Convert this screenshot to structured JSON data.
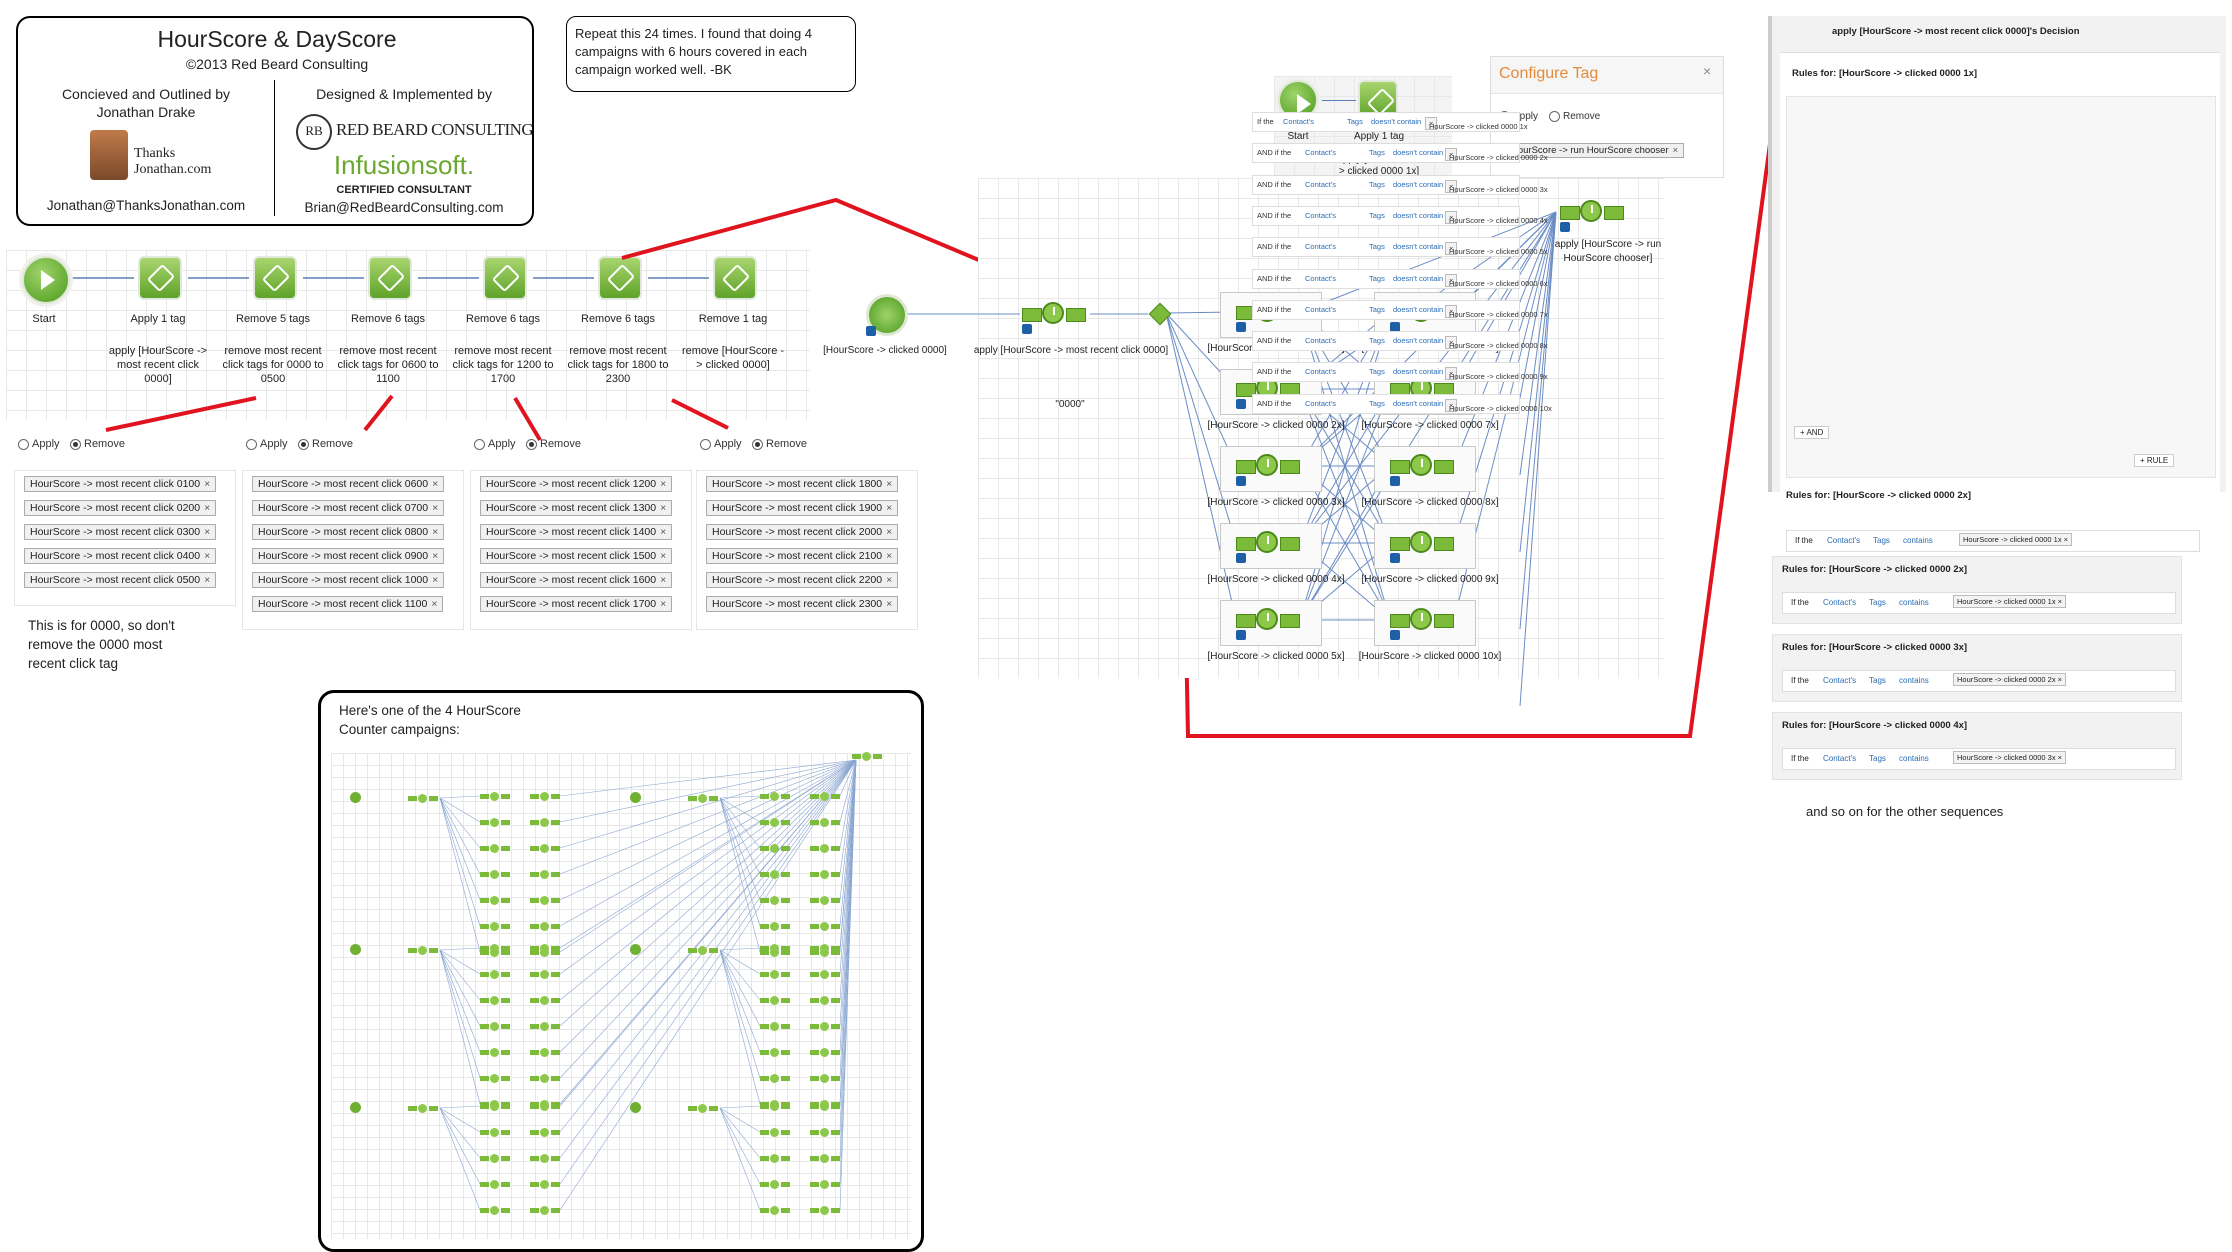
{
  "title_box": {
    "title": "HourScore & DayScore",
    "copyright": "©2013 Red Beard Consulting",
    "conceived_label": "Concieved and Outlined by",
    "conceived_name": "Jonathan Drake",
    "thanks_logo": "Thanks Jonathan.com",
    "email_left": "Jonathan@ThanksJonathan.com",
    "designed_label": "Designed & Implemented by",
    "rbc_logo": "RED BEARD CONSULTING",
    "infusion_logo": "Infusionsoft.",
    "certified": "CERTIFIED CONSULTANT",
    "email_right": "Brian@RedBeardConsulting.com"
  },
  "note": "Repeat this 24 times. I found that doing 4 campaigns with 6 hours covered in each campaign worked well. -BK",
  "flow": {
    "start_label": "Start",
    "nodes": [
      {
        "label": "Apply 1 tag",
        "desc": "apply [HourScore -> most recent click 0000]"
      },
      {
        "label": "Remove 5 tags",
        "desc": "remove most recent click tags for 0000 to 0500"
      },
      {
        "label": "Remove 6 tags",
        "desc": "remove most recent click tags for 0600 to 1100"
      },
      {
        "label": "Remove 6 tags",
        "desc": "remove most recent click tags for 1200 to 1700"
      },
      {
        "label": "Remove 6 tags",
        "desc": "remove most recent click tags for 1800 to 2300"
      },
      {
        "label": "Remove 1 tag",
        "desc": "remove [HourScore -> clicked 0000]"
      }
    ]
  },
  "radio": {
    "apply": "Apply",
    "remove": "Remove"
  },
  "tag_groups": [
    [
      "HourScore -> most recent click 0100",
      "HourScore -> most recent click 0200",
      "HourScore -> most recent click 0300",
      "HourScore -> most recent click 0400",
      "HourScore -> most recent click 0500"
    ],
    [
      "HourScore -> most recent click 0600",
      "HourScore -> most recent click 0700",
      "HourScore -> most recent click 0800",
      "HourScore -> most recent click 0900",
      "HourScore -> most recent click 1000",
      "HourScore -> most recent click 1100"
    ],
    [
      "HourScore -> most recent click 1200",
      "HourScore -> most recent click 1300",
      "HourScore -> most recent click 1400",
      "HourScore -> most recent click 1500",
      "HourScore -> most recent click 1600",
      "HourScore -> most recent click 1700"
    ],
    [
      "HourScore -> most recent click 1800",
      "HourScore -> most recent click 1900",
      "HourScore -> most recent click 2000",
      "HourScore -> most recent click 2100",
      "HourScore -> most recent click 2200",
      "HourScore -> most recent click 2300"
    ]
  ],
  "note_0000": "This is for 0000, so don't remove the 0000 most recent click tag",
  "counter_box_title": "Here's one of the 4 HourScore Counter campaigns:",
  "campaign": {
    "goal_label": "[HourScore -> clicked 0000]",
    "seq_label": "apply [HourScore -> most recent click 0000]",
    "decision_label": "\"0000\"",
    "col1": [
      "[HourScore -> clicked 0000 1x]",
      "[HourScore -> clicked 0000 2x]",
      "[HourScore -> clicked 0000 3x]",
      "[HourScore -> clicked 0000 4x]",
      "[HourScore -> clicked 0000 5x]"
    ],
    "col2": [
      "[HourScore -> clicked 0000 6x]",
      "[HourScore -> clicked 0000 7x]",
      "[HourScore -> clicked 0000 8x]",
      "[HourScore -> clicked 0000 9x]",
      "[HourScore -> clicked 0000 10x]"
    ],
    "chooser_label": "apply [HourScore -> run HourScore chooser]"
  },
  "mini_flow": {
    "start_label": "Start",
    "tag_label": "Apply 1 tag",
    "desc": "apply [HourScore -> clicked 0000 1x]"
  },
  "configure_tag": {
    "title": "Configure Tag",
    "apply": "Apply",
    "remove": "Remove",
    "chip": "HourScore -> run HourScore chooser",
    "close": "×"
  },
  "decision_panel": {
    "header": "apply [HourScore -> most recent click 0000]'s Decision",
    "rules_1x_title": "Rules for: [HourScore -> clicked 0000 1x]",
    "rows": [
      {
        "prefix": "If the",
        "chip": "HourScore -> clicked 0000 1x"
      },
      {
        "prefix": "AND if the",
        "chip": "HourScore -> clicked 0000 2x"
      },
      {
        "prefix": "AND if the",
        "chip": "HourScore -> clicked 0000 3x"
      },
      {
        "prefix": "AND if the",
        "chip": "HourScore -> clicked 0000 4x"
      },
      {
        "prefix": "AND if the",
        "chip": "HourScore -> clicked 0000 5x"
      },
      {
        "prefix": "AND if the",
        "chip": "HourScore -> clicked 0000 6x"
      },
      {
        "prefix": "AND if the",
        "chip": "HourScore -> clicked 0000 7x"
      },
      {
        "prefix": "AND if the",
        "chip": "HourScore -> clicked 0000 8x"
      },
      {
        "prefix": "AND if the",
        "chip": "HourScore -> clicked 0000 9x"
      },
      {
        "prefix": "AND if the",
        "chip": "HourScore -> clicked 0000 10x"
      }
    ],
    "contacts": "Contact's",
    "tags": "Tags",
    "doesnt_contain": "doesn't contain",
    "contains": "contains",
    "add_and": "+ AND",
    "add_rule": "+ RULE",
    "rules_2x_title": "Rules for: [HourScore -> clicked 0000 2x]",
    "rules_2x_chip": "HourScore -> clicked 0000 1x",
    "stack": [
      {
        "title": "Rules for: [HourScore -> clicked 0000 2x]",
        "chip": "HourScore -> clicked 0000 1x"
      },
      {
        "title": "Rules for: [HourScore -> clicked 0000 3x]",
        "chip": "HourScore -> clicked 0000 2x"
      },
      {
        "title": "Rules for: [HourScore -> clicked 0000 4x]",
        "chip": "HourScore -> clicked 0000 3x"
      }
    ],
    "footer": "and so on for the other sequences"
  },
  "colors": {
    "annotation_red": "#e0141e",
    "node_green": "#7cba3a",
    "link_blue": "#2a6db5"
  }
}
